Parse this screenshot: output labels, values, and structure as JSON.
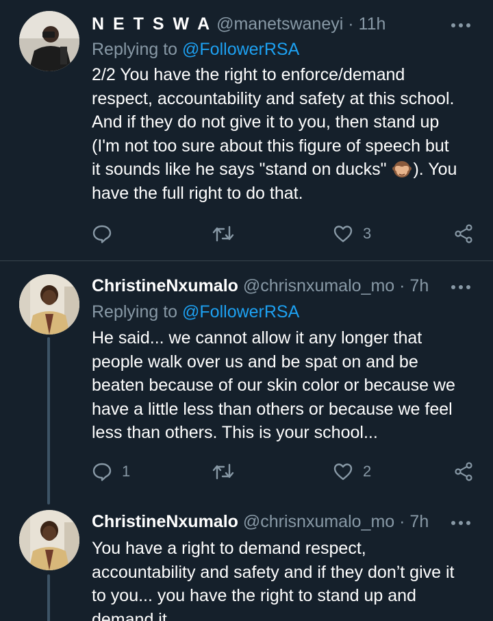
{
  "tweets": [
    {
      "display_name": "N E T S W A",
      "handle": "@manetswaneyi",
      "separator": "·",
      "time": "11h",
      "replying_prefix": "Replying to",
      "replying_to": "@FollowerRSA",
      "text_before_emoji": "2/2 You have the right to enforce/demand\nrespect, accountability and safety at this school.\nAnd if they do not give it to you, then stand up\n(I'm not too sure about this figure of speech but\nit sounds like he says \"stand on ducks\" ",
      "emoji": "see-no-evil-monkey",
      "text_after_emoji": "). You\nhave the full right to do that.",
      "reply_count": "",
      "retweet_count": "",
      "like_count": "3"
    },
    {
      "display_name": "ChristineNxumalo",
      "handle": "@chrisnxumalo_mo",
      "separator": "·",
      "time": "7h",
      "replying_prefix": "Replying to",
      "replying_to": "@FollowerRSA",
      "text": "He said... we cannot allow it any longer that\npeople walk over us and be spat on and be\nbeaten because of our skin color or because we\nhave a little less than others or because we feel\nless than others. This is your school...",
      "reply_count": "1",
      "retweet_count": "",
      "like_count": "2"
    },
    {
      "display_name": "ChristineNxumalo",
      "handle": "@chrisnxumalo_mo",
      "separator": "·",
      "time": "7h",
      "text": "You have a right to demand respect,\naccountability and safety and if they don’t give it\nto you... you have the right to stand up and\ndemand it"
    }
  ],
  "icons": {
    "reply": "reply-icon",
    "retweet": "retweet-icon",
    "like": "like-icon",
    "share": "share-icon",
    "more": "more-icon"
  },
  "colors": {
    "background": "#15202b",
    "text_primary": "#ffffff",
    "text_secondary": "#8899a6",
    "link": "#1da1f2",
    "divider": "#38444d",
    "thread_line": "#3d5466"
  }
}
